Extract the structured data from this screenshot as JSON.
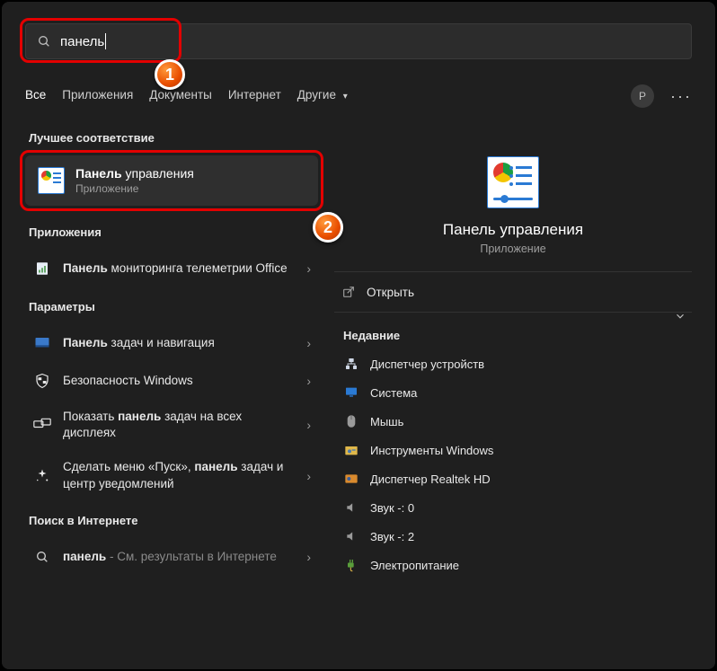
{
  "search": {
    "query": "панель"
  },
  "tabs": {
    "all": "Все",
    "apps": "Приложения",
    "docs": "Документы",
    "web": "Интернет",
    "other": "Другие",
    "avatar_initial": "P"
  },
  "left": {
    "best_heading": "Лучшее соответствие",
    "best_match": {
      "title_bold": "Панель",
      "title_rest": " управления",
      "subtitle": "Приложение"
    },
    "apps_heading": "Приложения",
    "app1_bold": "Панель",
    "app1_rest": " мониторинга телеметрии Office",
    "settings_heading": "Параметры",
    "s1_bold": "Панель",
    "s1_rest": " задач и навигация",
    "s2": "Безопасность Windows",
    "s3_a": "Показать ",
    "s3_b": "панель",
    "s3_c": " задач на всех дисплеях",
    "s4_a": "Сделать меню «Пуск», ",
    "s4_b": "панель",
    "s4_c": " задач и центр уведомлений",
    "web_heading": "Поиск в Интернете",
    "w1_bold": "панель",
    "w1_rest": " - См. результаты в Интернете"
  },
  "right": {
    "hero_title": "Панель управления",
    "hero_sub": "Приложение",
    "open_label": "Открыть",
    "recent_heading": "Недавние",
    "recent": [
      "Диспетчер устройств",
      "Система",
      "Мышь",
      "Инструменты Windows",
      "Диспетчер Realtek HD",
      "Звук -: 0",
      "Звук -: 2",
      "Электропитание"
    ]
  },
  "badges": {
    "one": "1",
    "two": "2"
  }
}
